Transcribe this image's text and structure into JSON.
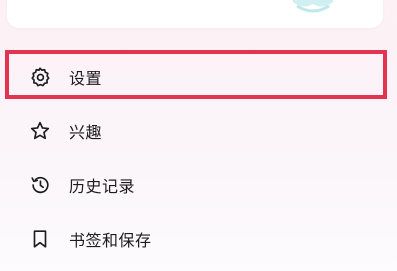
{
  "menu": {
    "items": [
      {
        "label": "设置",
        "icon": "gear-icon"
      },
      {
        "label": "兴趣",
        "icon": "star-icon"
      },
      {
        "label": "历史记录",
        "icon": "history-icon"
      },
      {
        "label": "书签和保存",
        "icon": "bookmark-icon"
      }
    ]
  },
  "highlight": {
    "target": "settings",
    "color": "#e23450"
  }
}
